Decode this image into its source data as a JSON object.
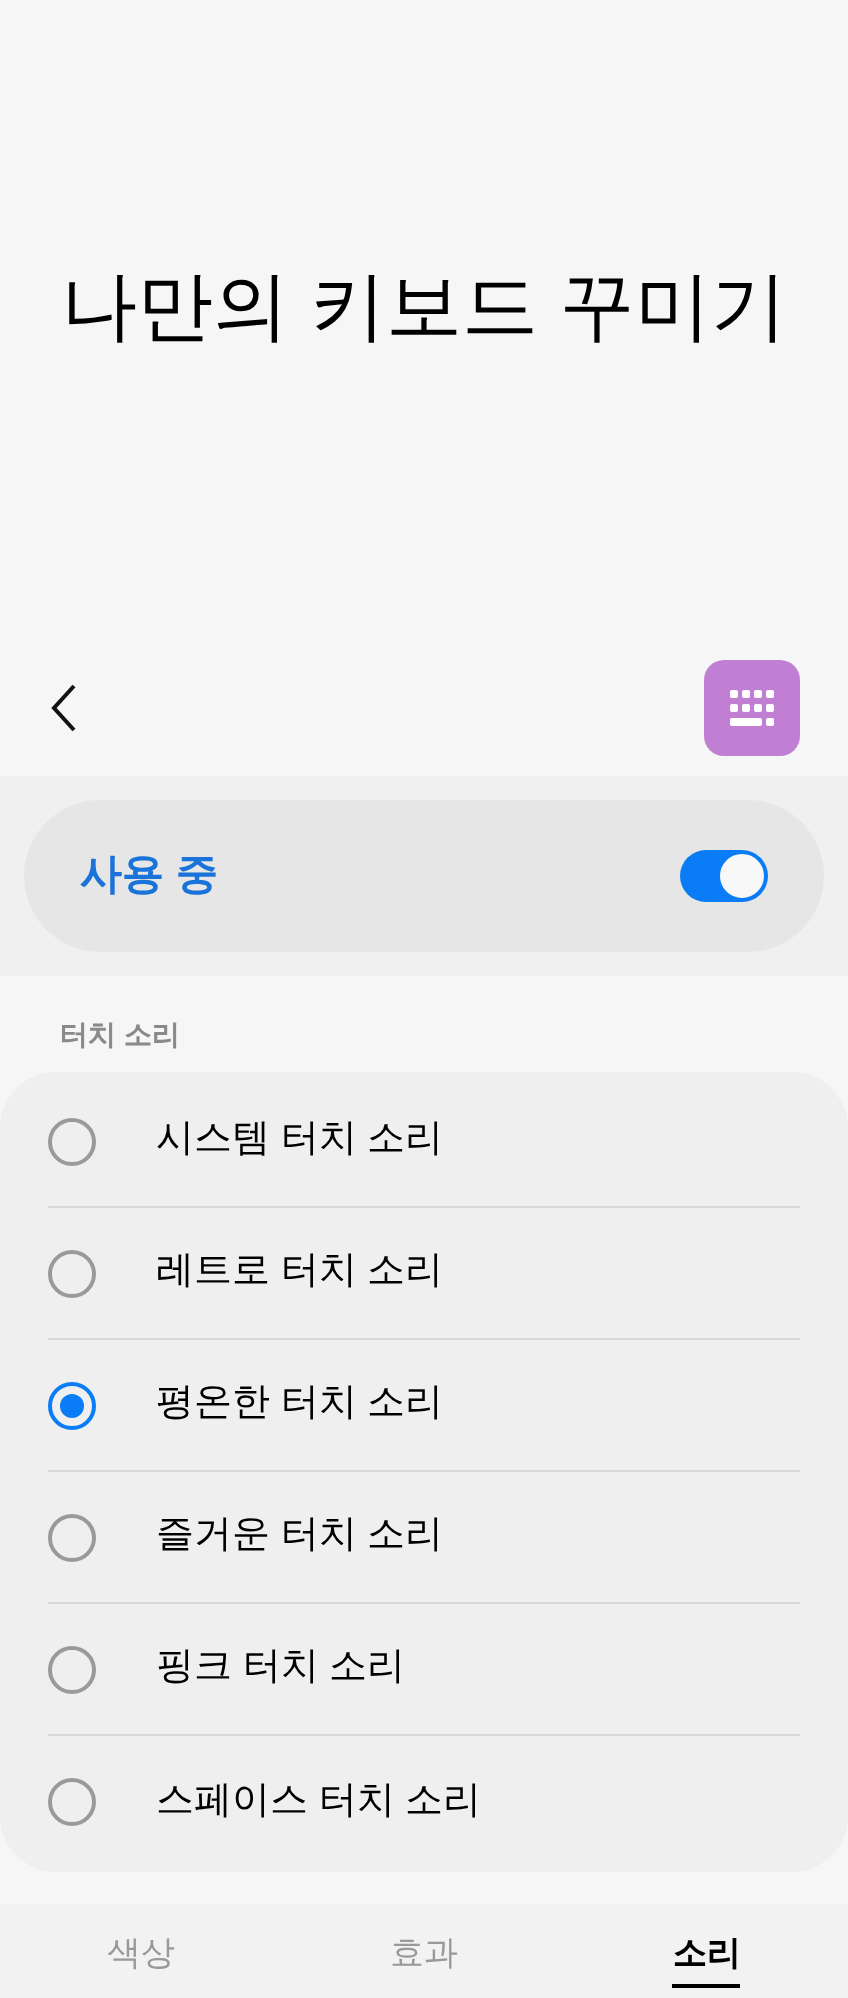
{
  "title": "나만의 키보드 꾸미기",
  "master": {
    "label": "사용 중",
    "on": true
  },
  "section": "터치 소리",
  "options": [
    {
      "label": "시스템 터치 소리",
      "selected": false
    },
    {
      "label": "레트로 터치 소리",
      "selected": false
    },
    {
      "label": "평온한 터치 소리",
      "selected": true
    },
    {
      "label": "즐거운 터치 소리",
      "selected": false
    },
    {
      "label": "핑크 터치 소리",
      "selected": false
    },
    {
      "label": "스페이스 터치 소리",
      "selected": false
    }
  ],
  "tabs": [
    {
      "label": "색상",
      "selected": false
    },
    {
      "label": "효과",
      "selected": false
    },
    {
      "label": "소리",
      "selected": true
    }
  ]
}
